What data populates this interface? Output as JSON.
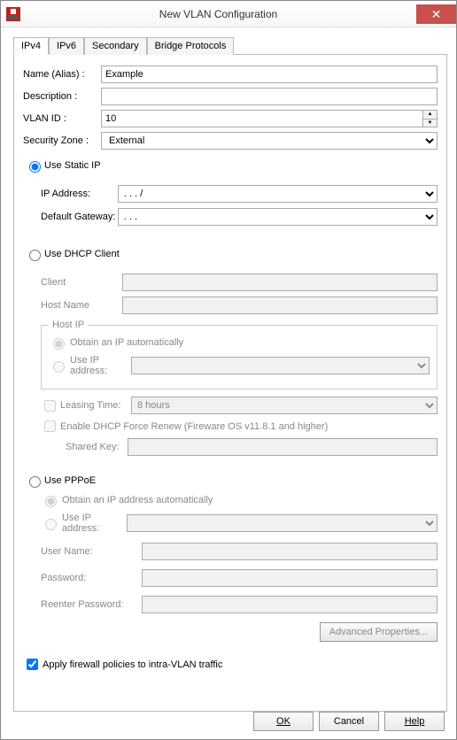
{
  "window": {
    "title": "New VLAN Configuration"
  },
  "tabs": [
    "IPv4",
    "IPv6",
    "Secondary",
    "Bridge Protocols"
  ],
  "form": {
    "name_label": "Name (Alias) :",
    "name_value": "Example",
    "desc_label": "Description :",
    "desc_value": "",
    "vlan_label": "VLAN ID :",
    "vlan_value": "10",
    "zone_label": "Security Zone :",
    "zone_value": "External"
  },
  "static": {
    "radio_label": "Use Static IP",
    "ip_label": "IP Address:",
    "ip_value": "  .   .   .     /",
    "gw_label": "Default Gateway:",
    "gw_value": "  .   .   ."
  },
  "dhcp": {
    "radio_label": "Use DHCP Client",
    "client_label": "Client",
    "client_value": "",
    "hostname_label": "Host Name",
    "hostname_value": "",
    "hostip_legend": "Host IP",
    "auto_label": "Obtain an IP automatically",
    "useip_label": "Use IP address:",
    "useip_value": "",
    "lease_chk": "Leasing Time:",
    "lease_value": "8 hours",
    "force_chk": "Enable DHCP Force Renew (Fireware OS v11.8.1 and higher)",
    "shared_label": "Shared Key:",
    "shared_value": ""
  },
  "pppoe": {
    "radio_label": "Use PPPoE",
    "auto_label": "Obtain an IP address automatically",
    "useip_label": "Use IP address:",
    "useip_value": "",
    "user_label": "User Name:",
    "user_value": "",
    "pass_label": "Password:",
    "pass_value": "",
    "repass_label": "Reenter Password:",
    "repass_value": "",
    "adv_btn": "Advanced Properties..."
  },
  "apply_chk": "Apply firewall policies to intra-VLAN traffic",
  "buttons": {
    "ok": "OK",
    "cancel": "Cancel",
    "help": "Help"
  }
}
